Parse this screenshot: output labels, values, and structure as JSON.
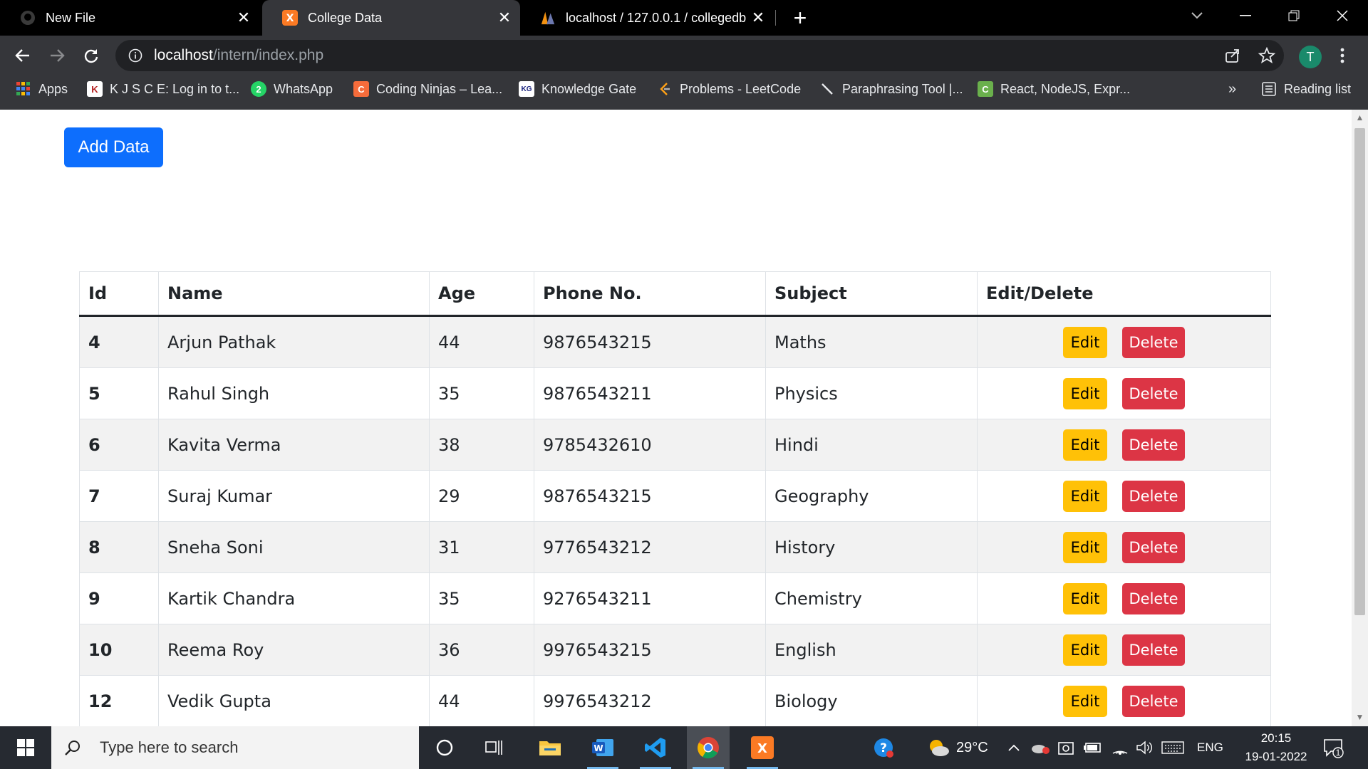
{
  "tabs": [
    {
      "title": "New File",
      "icon": "github-icon"
    },
    {
      "title": "College Data",
      "icon": "xampp-icon"
    },
    {
      "title": "localhost / 127.0.0.1 / collegedb",
      "icon": "phpmyadmin-icon"
    }
  ],
  "address": {
    "host": "localhost",
    "path": "/intern/index.php"
  },
  "profile_initial": "T",
  "bookmarks": [
    {
      "label": "Apps",
      "icon": "apps-grid-icon"
    },
    {
      "label": "K J S C E: Log in to t...",
      "icon": "kjsce-icon"
    },
    {
      "label": "WhatsApp",
      "icon": "whatsapp-icon"
    },
    {
      "label": "Coding Ninjas – Lea...",
      "icon": "coding-ninjas-icon"
    },
    {
      "label": "Knowledge Gate",
      "icon": "knowledge-gate-icon"
    },
    {
      "label": "Problems - LeetCode",
      "icon": "leetcode-icon"
    },
    {
      "label": "Paraphrasing Tool |...",
      "icon": "quill-icon"
    },
    {
      "label": "React, NodeJS, Expr...",
      "icon": "react-node-icon"
    }
  ],
  "bookmarks_overflow": "»",
  "reading_list": "Reading list",
  "page": {
    "add_button": "Add Data",
    "columns": [
      "Id",
      "Name",
      "Age",
      "Phone No.",
      "Subject",
      "Edit/Delete"
    ],
    "rows": [
      {
        "id": "4",
        "name": "Arjun Pathak",
        "age": "44",
        "phone": "9876543215",
        "subject": "Maths"
      },
      {
        "id": "5",
        "name": "Rahul Singh",
        "age": "35",
        "phone": "9876543211",
        "subject": "Physics"
      },
      {
        "id": "6",
        "name": "Kavita Verma",
        "age": "38",
        "phone": "9785432610",
        "subject": "Hindi"
      },
      {
        "id": "7",
        "name": "Suraj Kumar",
        "age": "29",
        "phone": "9876543215",
        "subject": "Geography"
      },
      {
        "id": "8",
        "name": "Sneha Soni",
        "age": "31",
        "phone": "9776543212",
        "subject": "History"
      },
      {
        "id": "9",
        "name": "Kartik Chandra",
        "age": "35",
        "phone": "9276543211",
        "subject": "Chemistry"
      },
      {
        "id": "10",
        "name": "Reema Roy",
        "age": "36",
        "phone": "9976543215",
        "subject": "English"
      },
      {
        "id": "12",
        "name": "Vedik Gupta",
        "age": "44",
        "phone": "9976543212",
        "subject": "Biology"
      }
    ],
    "edit_label": "Edit",
    "delete_label": "Delete"
  },
  "colors": {
    "primary": "#0d6efd",
    "warning": "#ffc107",
    "danger": "#dc3545"
  },
  "taskbar": {
    "search_placeholder": "Type here to search",
    "temperature": "29°C",
    "language": "ENG",
    "time": "20:15",
    "date": "19-01-2022",
    "notification_count": "1"
  }
}
